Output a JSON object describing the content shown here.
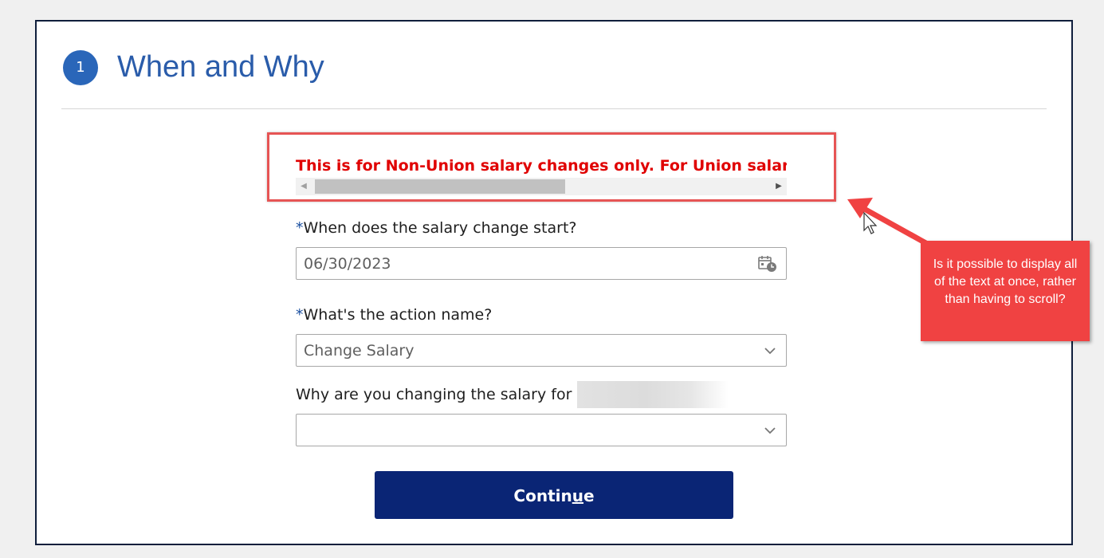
{
  "section": {
    "step_number": "1",
    "title": "When and Why"
  },
  "banner": {
    "text": "This is for Non-Union salary changes only. For Union salary changes"
  },
  "fields": {
    "start_date": {
      "required_mark": "*",
      "label": "When does the salary change start?",
      "value": "06/30/2023"
    },
    "action_name": {
      "required_mark": "*",
      "label": "What's the action name?",
      "value": "Change Salary"
    },
    "reason": {
      "label": "Why are you changing the salary for",
      "value": ""
    }
  },
  "continue_button": {
    "label_before": "Contin",
    "label_underlined": "u",
    "label_after": "e"
  },
  "annotation": {
    "text": "Is it possible to display all of the text at once, rather than having to scroll?"
  },
  "colors": {
    "accent_blue": "#2a66b9",
    "button_navy": "#0a2575",
    "banner_red": "#e00000",
    "annotation_red": "#f04242"
  }
}
